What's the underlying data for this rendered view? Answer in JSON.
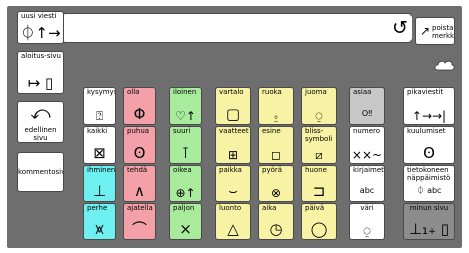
{
  "top": {
    "new_message": {
      "label": "uusi viesti",
      "symbol": "⏀↑→",
      "icon": "new-message-icon"
    },
    "text_value": "",
    "undo": {
      "symbol": "↺",
      "icon": "undo-icon"
    },
    "delete_char": {
      "label": "poista merkki",
      "symbol": "↗",
      "icon": "delete-char-icon"
    }
  },
  "side": {
    "home_page": {
      "label": "aloitus-sivu",
      "symbol": "↦ ▯",
      "icon": "home-page-icon"
    },
    "previous_page": {
      "label": "edellinen sivu",
      "symbol": "⤺",
      "icon": "previous-page-icon"
    },
    "comment": {
      "label": "kommentosivulle"
    }
  },
  "grid": [
    [
      {
        "label": "kysymys",
        "symbol": "⍰",
        "color": "#ffffff"
      },
      {
        "label": "olla",
        "symbol": "Φ",
        "color": "#f4a0a8"
      },
      {
        "label": "iloinen",
        "symbol": "♡↑",
        "color": "#a8eb9c"
      },
      {
        "label": "vartalo",
        "symbol": "▢",
        "color": "#f8f3a4"
      },
      {
        "label": "ruoka",
        "symbol": "⍛",
        "color": "#f8f3a4"
      },
      {
        "label": "juoma",
        "symbol": "⍜",
        "color": "#f8f3a4"
      },
      {
        "label": "asiaa",
        "symbol": "O‼",
        "color": "#c7c7c7"
      }
    ],
    [
      {
        "label": "kaikki",
        "symbol": "⊠",
        "color": "#ffffff"
      },
      {
        "label": "puhua",
        "symbol": "ʘ",
        "color": "#f4a0a8"
      },
      {
        "label": "suuri",
        "symbol": "⊺",
        "color": "#a8eb9c"
      },
      {
        "label": "vaatteet",
        "symbol": "⊞",
        "color": "#f8f3a4"
      },
      {
        "label": "esine",
        "symbol": "◻",
        "color": "#f8f3a4"
      },
      {
        "label": "bliss-symboli",
        "symbol": "⧄",
        "color": "#f8f3a4"
      },
      {
        "label": "numero",
        "symbol": "××~",
        "color": "#ffffff"
      }
    ],
    [
      {
        "label": "ihminen",
        "symbol": "⊥",
        "color": "#6ef0f0"
      },
      {
        "label": "tehdä",
        "symbol": "∧",
        "color": "#f4a0a8"
      },
      {
        "label": "oikea",
        "symbol": "⊕↑",
        "color": "#a8eb9c"
      },
      {
        "label": "paikka",
        "symbol": "⌣",
        "color": "#f8f3a4"
      },
      {
        "label": "pyörä",
        "symbol": "⊗",
        "color": "#f8f3a4"
      },
      {
        "label": "huone",
        "symbol": "⊐",
        "color": "#f8f3a4"
      },
      {
        "label": "kirjaimet",
        "symbol": "abc",
        "color": "#ffffff"
      }
    ],
    [
      {
        "label": "perhe",
        "symbol": "⩙",
        "color": "#6ef0f0"
      },
      {
        "label": "ajatella",
        "symbol": "⌒",
        "color": "#f4a0a8"
      },
      {
        "label": "paljon",
        "symbol": "×",
        "color": "#a8eb9c"
      },
      {
        "label": "luonto",
        "symbol": "△",
        "color": "#f8f3a4"
      },
      {
        "label": "aika",
        "symbol": "◷",
        "color": "#f8f3a4"
      },
      {
        "label": "päivä",
        "symbol": "◯",
        "color": "#f8f3a4"
      },
      {
        "label": "väri",
        "symbol": "⍜",
        "color": "#ffffff"
      }
    ]
  ],
  "right": [
    {
      "label": "pikaviestit",
      "symbol": "↑→→|",
      "color": "#ffffff"
    },
    {
      "label": "kuulumiset",
      "symbol": "ʘ",
      "color": "#ffffff"
    },
    {
      "label": "tietokoneen näppäimistö",
      "symbol": "⏀ abc",
      "color": "#ffffff"
    },
    {
      "label": "minun sivu",
      "symbol": "⊥₁₊ ▯",
      "color": "#8c8c8c"
    }
  ],
  "colors": {
    "frame": "#6e6e6e",
    "person": "#6ef0f0",
    "action": "#f4a0a8",
    "description": "#a8eb9c",
    "thing": "#f8f3a4",
    "small": "#c7c7c7",
    "my_page": "#8c8c8c",
    "indicator": "#1a8a1a"
  }
}
